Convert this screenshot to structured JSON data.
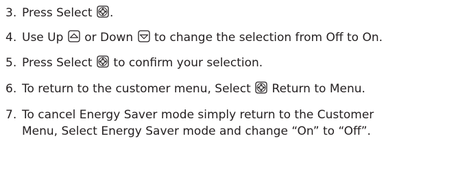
{
  "steps": [
    {
      "number": "3.",
      "parts": [
        "Press Select",
        "."
      ],
      "icons": [
        "select-icon"
      ]
    },
    {
      "number": "4.",
      "parts": [
        "Use Up",
        "or Down",
        "to change the selection from Off to On."
      ],
      "icons": [
        "up-icon",
        "down-icon"
      ]
    },
    {
      "number": "5.",
      "parts": [
        "Press Select",
        "to confirm your selection."
      ],
      "icons": [
        "select-icon"
      ]
    },
    {
      "number": "6.",
      "parts": [
        "To return to the customer menu, Select",
        "Return to Menu."
      ],
      "icons": [
        "select-icon"
      ]
    },
    {
      "number": "7.",
      "lines": [
        "To cancel Energy Saver mode simply return to the Customer",
        "Menu, Select Energy Saver mode and change “On” to “Off”."
      ]
    }
  ]
}
